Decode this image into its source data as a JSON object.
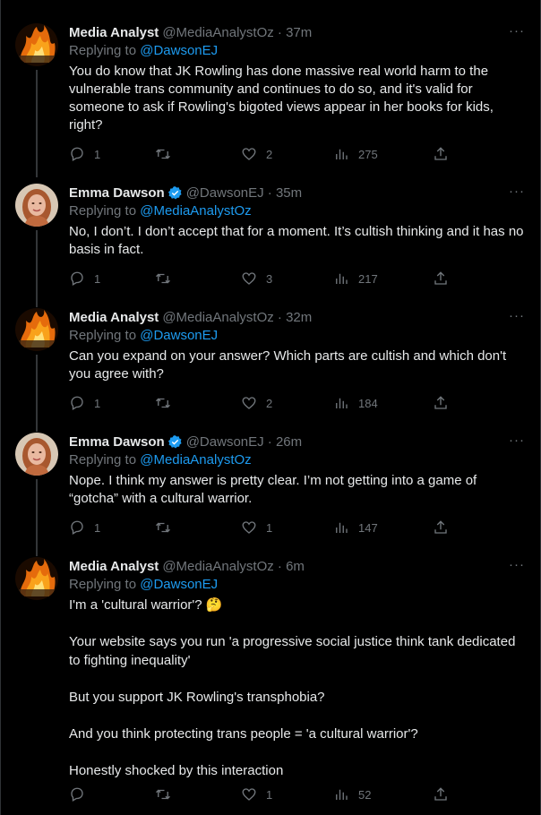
{
  "tweets": [
    {
      "name": "Media Analyst",
      "handle": "@MediaAnalystOz · 37m",
      "verified": false,
      "replying_prefix": "Replying to ",
      "replying_to": "@DawsonEJ",
      "text": "You do know that JK Rowling has done massive real world harm to the vulnerable trans community and continues to do so, and it's valid for someone to ask if Rowling's bigoted views appear in her books for kids, right?",
      "replies": "1",
      "retweets": "",
      "likes": "2",
      "views": "275",
      "avatar": "fire-avatar"
    },
    {
      "name": "Emma Dawson",
      "handle": "@DawsonEJ · 35m",
      "verified": true,
      "replying_prefix": "Replying to ",
      "replying_to": "@MediaAnalystOz",
      "text": "No, I don’t. I don’t accept that for a moment. It’s cultish thinking and it has no basis in fact.",
      "replies": "1",
      "retweets": "",
      "likes": "3",
      "views": "217",
      "avatar": "portrait-avatar"
    },
    {
      "name": "Media Analyst",
      "handle": "@MediaAnalystOz · 32m",
      "verified": false,
      "replying_prefix": "Replying to ",
      "replying_to": "@DawsonEJ",
      "text": "Can you expand on your answer? Which parts are cultish and which don't you agree with?",
      "replies": "1",
      "retweets": "",
      "likes": "2",
      "views": "184",
      "avatar": "fire-avatar"
    },
    {
      "name": "Emma Dawson",
      "handle": "@DawsonEJ · 26m",
      "verified": true,
      "replying_prefix": "Replying to ",
      "replying_to": "@MediaAnalystOz",
      "text": "Nope. I think my answer is pretty clear. I’m not getting into a game of “gotcha” with a cultural warrior.",
      "replies": "1",
      "retweets": "",
      "likes": "1",
      "views": "147",
      "avatar": "portrait-avatar"
    },
    {
      "name": "Media Analyst",
      "handle": "@MediaAnalystOz · 6m",
      "verified": false,
      "replying_prefix": "Replying to ",
      "replying_to": "@DawsonEJ",
      "text": "I'm a 'cultural warrior'? 🤔\n\nYour website says you run 'a progressive social justice think tank dedicated to fighting inequality'\n\nBut you support JK Rowling's transphobia?\n\nAnd you think protecting trans people = 'a cultural warrior'?\n\nHonestly shocked by this interaction",
      "replies": "",
      "retweets": "",
      "likes": "1",
      "views": "52",
      "avatar": "fire-avatar"
    }
  ],
  "colors": {
    "background": "#000000",
    "text": "#e7e9ea",
    "muted": "#71767b",
    "link": "#1d9bf0"
  }
}
